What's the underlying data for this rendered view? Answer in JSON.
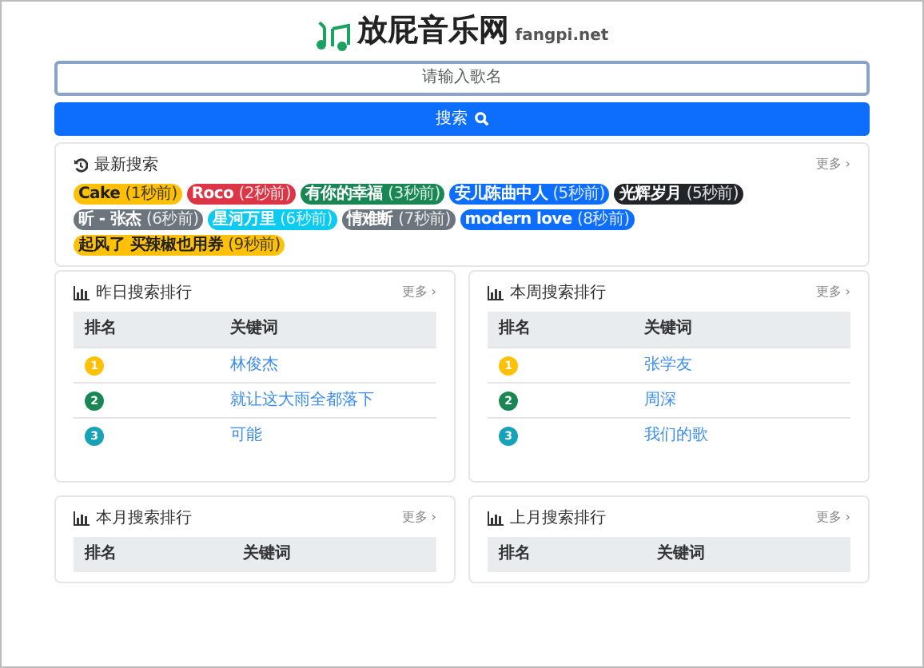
{
  "header": {
    "title": "放屁音乐网",
    "domain": "fangpi.net"
  },
  "search": {
    "placeholder": "请输入歌名",
    "button": "搜索"
  },
  "latest": {
    "title": "最新搜索",
    "more": "更多 ›",
    "tags": [
      {
        "name": "Cake",
        "time": "(1秒前)",
        "color": "#ffc107"
      },
      {
        "name": "Roco",
        "time": "(2秒前)",
        "color": "#dc3545"
      },
      {
        "name": "有你的幸福",
        "time": "(3秒前)",
        "color": "#198754"
      },
      {
        "name": "安儿陈曲中人",
        "time": "(5秒前)",
        "color": "#0d6efd"
      },
      {
        "name": "光辉岁月",
        "time": "(5秒前)",
        "color": "#212529"
      },
      {
        "name": "昕 - 张杰",
        "time": "(6秒前)",
        "color": "#6c757d"
      },
      {
        "name": "星河万里",
        "time": "(6秒前)",
        "color": "#0dcaf0"
      },
      {
        "name": "情难断",
        "time": "(7秒前)",
        "color": "#6c757d"
      },
      {
        "name": "modern love",
        "time": "(8秒前)",
        "color": "#0d6efd"
      },
      {
        "name": "起风了 买辣椒也用券",
        "time": "(9秒前)",
        "color": "#ffc107"
      }
    ]
  },
  "rankings": [
    {
      "title": "昨日搜索排行",
      "more": "更多 ›",
      "columns": [
        "排名",
        "关键词"
      ],
      "rows": [
        {
          "rank": "1",
          "keyword": "林俊杰",
          "color": "#ffc107"
        },
        {
          "rank": "2",
          "keyword": "就让这大雨全都落下",
          "color": "#198754"
        },
        {
          "rank": "3",
          "keyword": "可能",
          "color": "#17a2b8"
        }
      ]
    },
    {
      "title": "本周搜索排行",
      "more": "更多 ›",
      "columns": [
        "排名",
        "关键词"
      ],
      "rows": [
        {
          "rank": "1",
          "keyword": "张学友",
          "color": "#ffc107"
        },
        {
          "rank": "2",
          "keyword": "周深",
          "color": "#198754"
        },
        {
          "rank": "3",
          "keyword": "我们的歌",
          "color": "#17a2b8"
        }
      ]
    },
    {
      "title": "本月搜索排行",
      "more": "更多 ›",
      "columns": [
        "排名",
        "关键词"
      ]
    },
    {
      "title": "上月搜索排行",
      "more": "更多 ›",
      "columns": [
        "排名",
        "关键词"
      ]
    }
  ]
}
